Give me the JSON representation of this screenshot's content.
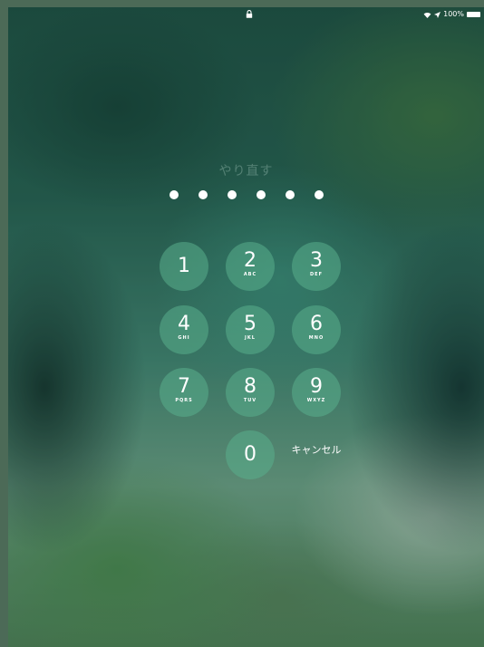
{
  "status_bar": {
    "lock_icon": "lock-icon",
    "wifi_icon": "wifi-icon",
    "location_icon": "location-arrow-icon",
    "battery_text": "100%",
    "battery_icon": "battery-icon"
  },
  "passcode": {
    "title": "やり直す",
    "entered_digits": 6
  },
  "keypad": {
    "keys": [
      {
        "digit": "1",
        "letters": ""
      },
      {
        "digit": "2",
        "letters": "ABC"
      },
      {
        "digit": "3",
        "letters": "DEF"
      },
      {
        "digit": "4",
        "letters": "GHI"
      },
      {
        "digit": "5",
        "letters": "JKL"
      },
      {
        "digit": "6",
        "letters": "MNO"
      },
      {
        "digit": "7",
        "letters": "PQRS"
      },
      {
        "digit": "8",
        "letters": "TUV"
      },
      {
        "digit": "9",
        "letters": "WXYZ"
      },
      {
        "digit": "0",
        "letters": ""
      }
    ],
    "cancel_label": "キャンセル"
  },
  "colors": {
    "key_background": "#5aaf8c",
    "text": "#ffffff"
  }
}
